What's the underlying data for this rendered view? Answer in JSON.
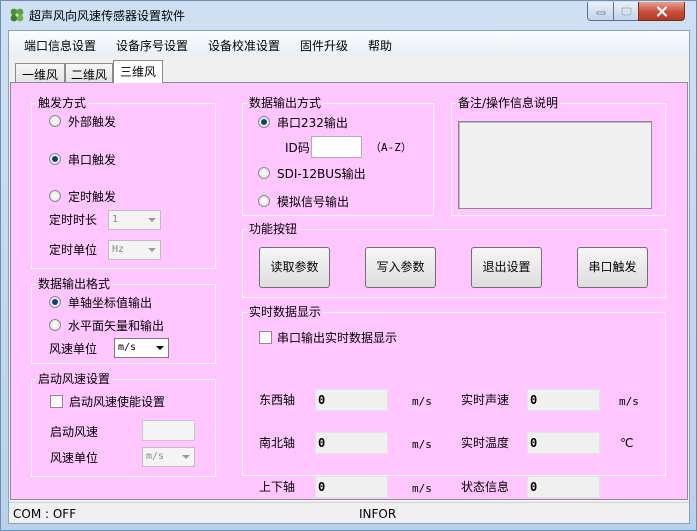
{
  "window": {
    "title": "超声风向风速传感器设置软件",
    "icon": "clover-app-icon"
  },
  "menu": [
    "端口信息设置",
    "设备序号设置",
    "设备校准设置",
    "固件升级",
    "帮助"
  ],
  "tabs": [
    "一维风",
    "二维风",
    "三维风"
  ],
  "active_tab": "三维风",
  "trigger": {
    "title": "触发方式",
    "external": "外部触发",
    "serial": "串口触发",
    "timed": "定时触发",
    "selected": "串口触发",
    "duration_label": "定时时长",
    "duration_value": "1",
    "unit_label": "定时单位",
    "unit_value": "Hz"
  },
  "format": {
    "title": "数据输出格式",
    "single_axis": "单轴坐标值输出",
    "horizontal": "水平面矢量和输出",
    "selected": "单轴坐标值输出",
    "speed_unit_label": "风速单位",
    "speed_unit_value": "m/s"
  },
  "startup": {
    "title": "启动风速设置",
    "enable_label": "启动风速使能设置",
    "enabled": false,
    "speed_label": "启动风速",
    "speed_value": "",
    "unit_label": "风速单位",
    "unit_value": "m/s"
  },
  "output": {
    "title": "数据输出方式",
    "rs232": "串口232输出",
    "id_label": "ID码",
    "id_value": "",
    "id_hint": "（A-Z）",
    "sdi12": "SDI-12BUS输出",
    "analog": "模拟信号输出",
    "selected": "串口232输出"
  },
  "notes": {
    "title": "备注/操作信息说明",
    "content": ""
  },
  "functions": {
    "title": "功能按钮",
    "read": "读取参数",
    "write": "写入参数",
    "exit": "退出设置",
    "trigger": "串口触发"
  },
  "realtime": {
    "title": "实时数据显示",
    "show_label": "串口输出实时数据显示",
    "show_checked": false,
    "east_west_label": "东西轴",
    "east_west_value": "0",
    "north_south_label": "南北轴",
    "north_south_value": "0",
    "up_down_label": "上下轴",
    "up_down_value": "0",
    "speed_unit": "m/s",
    "sound_speed_label": "实时声速",
    "sound_speed_value": "0",
    "sound_speed_unit": "m/s",
    "temp_label": "实时温度",
    "temp_value": "0",
    "temp_unit": "℃",
    "status_label": "状态信息",
    "status_value": "0"
  },
  "status": {
    "com": "COM : OFF",
    "info": "INFOR"
  }
}
